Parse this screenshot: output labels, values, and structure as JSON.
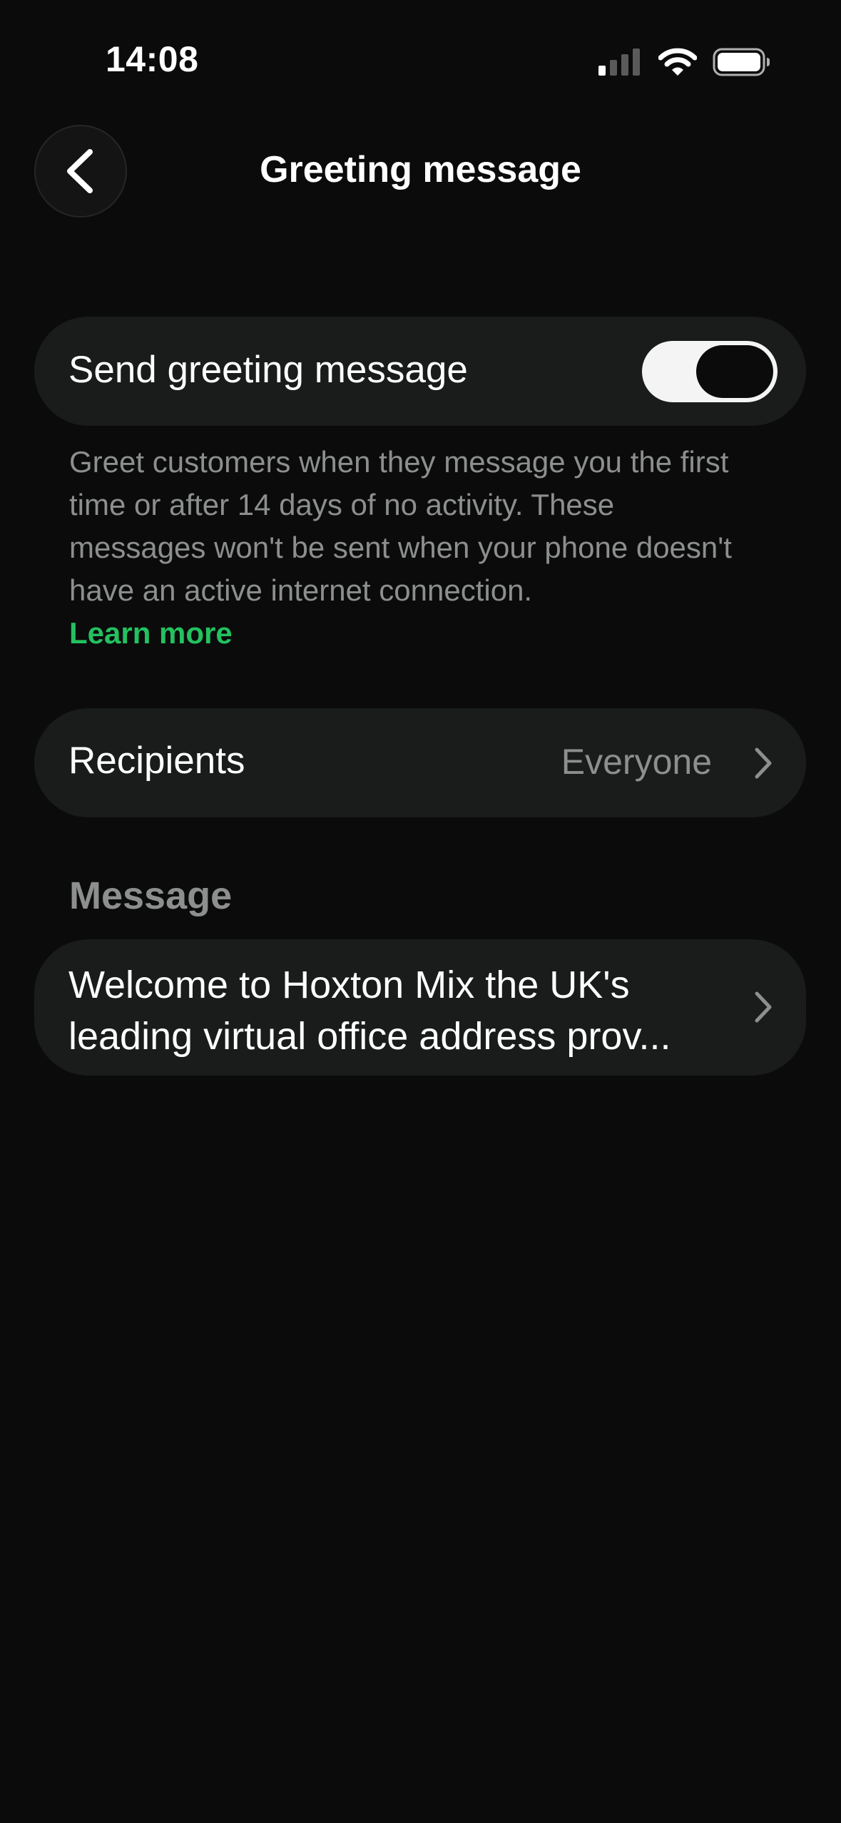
{
  "status_bar": {
    "time": "14:08",
    "icons": [
      "cellular-signal-icon",
      "wifi-icon",
      "battery-icon"
    ]
  },
  "nav": {
    "back_icon": "chevron-left-icon",
    "title": "Greeting message"
  },
  "greeting_toggle": {
    "label": "Send greeting message",
    "enabled": true
  },
  "description": {
    "text": "Greet customers when they message you the first time or after 14 days of no activity. These messages won't be sent when your phone doesn't have an active internet connection.",
    "link_label": "Learn more"
  },
  "recipients": {
    "label": "Recipients",
    "value": "Everyone",
    "icon": "chevron-right-icon"
  },
  "message_section": {
    "header": "Message",
    "text": "Welcome to Hoxton Mix the UK's leading virtual office address prov...",
    "icon": "chevron-right-icon"
  },
  "colors": {
    "background": "#0b0b0b",
    "card": "#1a1c1c",
    "secondary_text": "#8d8f8f",
    "accent_green": "#23c160"
  }
}
